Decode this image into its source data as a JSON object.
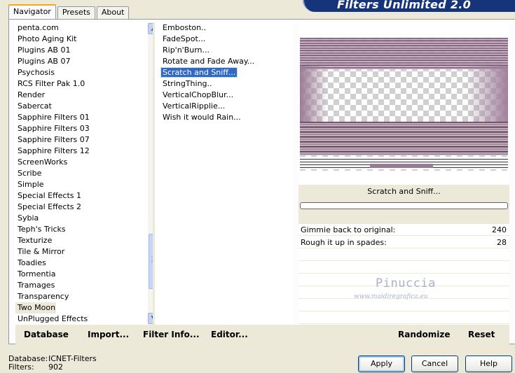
{
  "tabs": [
    {
      "label": "Navigator",
      "active": true
    },
    {
      "label": "Presets",
      "active": false
    },
    {
      "label": "About",
      "active": false
    }
  ],
  "banner": {
    "title": "Filters Unlimited 2.0"
  },
  "categories": {
    "items": [
      "penta.com",
      "Photo Aging Kit",
      "Plugins AB 01",
      "Plugins AB 07",
      "Psychosis",
      "RCS Filter Pak 1.0",
      "Render",
      "Sabercat",
      "Sapphire Filters 01",
      "Sapphire Filters 03",
      "Sapphire Filters 07",
      "Sapphire Filters 12",
      "ScreenWorks",
      "Scribe",
      "Simple",
      "Special Effects 1",
      "Special Effects 2",
      "Sybia",
      "Teph's Tricks",
      "Texturize",
      "Tile & Mirror",
      "Toadies",
      "Tormentia",
      "Tramages",
      "Transparency",
      "Two Moon",
      "UnPlugged Effects"
    ],
    "selected": "Two Moon"
  },
  "filters": {
    "items": [
      "Emboston..",
      "FadeSpot...",
      "Rip'n'Burn...",
      "Rotate and Fade Away...",
      "Scratch and Sniff...",
      "StringThing..",
      "VerticalChopBlur...",
      "VerticalRipplie...",
      "Wish it would Rain..."
    ],
    "selected": "Scratch and Sniff..."
  },
  "preview": {
    "filter_name": "Scratch and Sniff..."
  },
  "progress": {
    "value": 0
  },
  "params": [
    {
      "label": "Gimmie back to original:",
      "value": "240"
    },
    {
      "label": "Rough it up in spades:",
      "value": "28"
    }
  ],
  "watermark": {
    "line1": "Pinuccia",
    "line2": "www.maidiregrafica.eu"
  },
  "bottom_buttons": {
    "database": "Database",
    "import": "Import...",
    "filter_info": "Filter Info...",
    "editor": "Editor...",
    "randomize": "Randomize",
    "reset": "Reset"
  },
  "status": {
    "database_label": "Database:",
    "database_value": "ICNET-Filters",
    "filters_label": "Filters:",
    "filters_value": "902"
  },
  "dialog_buttons": {
    "apply": "Apply",
    "cancel": "Cancel",
    "help": "Help"
  }
}
